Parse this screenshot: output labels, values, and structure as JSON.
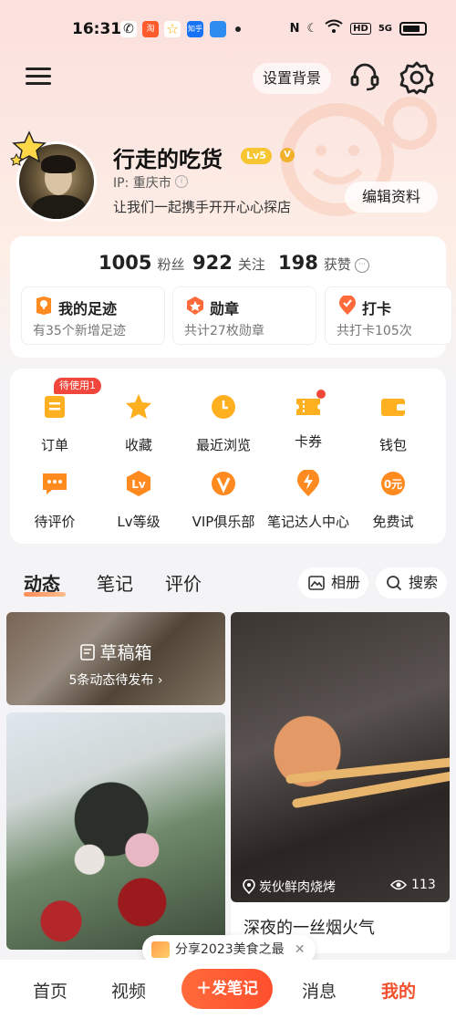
{
  "status_bar": {
    "time": "16:31",
    "apps": [
      {
        "icon": "wechat-icon",
        "color": "#222222"
      },
      {
        "icon": "taobao-icon",
        "color": "#ff5a2b"
      },
      {
        "icon": "star-app-icon",
        "color": "#f5b400"
      },
      {
        "icon": "zhihu-icon",
        "color": "#1772f6"
      },
      {
        "icon": "blue-app-icon",
        "color": "#2e8cf0"
      }
    ],
    "network": "5G",
    "hd": "HD"
  },
  "top_bar": {
    "set_background_label": "设置背景"
  },
  "profile": {
    "username": "行走的吃货",
    "level_badge": "Lv5",
    "v_badge": "V",
    "ip_label": "IP: 重庆市",
    "bio": "让我们一起携手开开心心探店",
    "edit_button": "编辑资料"
  },
  "stats": {
    "fans_count": "1005",
    "fans_label": "粉丝",
    "following_count": "922",
    "following_label": "关注",
    "likes_count": "198",
    "likes_label": "获赞"
  },
  "quick_cards": [
    {
      "title": "我的足迹",
      "subtitle": "有35个新增足迹",
      "icon": "map-pin-icon"
    },
    {
      "title": "勋章",
      "subtitle": "共计27枚勋章",
      "icon": "medal-icon"
    },
    {
      "title": "打卡",
      "subtitle": "共打卡105次",
      "icon": "checkin-icon"
    }
  ],
  "services": {
    "pending_badge": "待使用1",
    "row1": [
      {
        "label": "订单",
        "icon": "order-icon"
      },
      {
        "label": "收藏",
        "icon": "star-icon"
      },
      {
        "label": "最近浏览",
        "icon": "clock-icon"
      },
      {
        "label": "卡券",
        "icon": "coupon-icon"
      },
      {
        "label": "钱包",
        "icon": "wallet-icon"
      }
    ],
    "row2": [
      {
        "label": "待评价",
        "icon": "comment-icon"
      },
      {
        "label": "Lv等级",
        "icon": "level-icon"
      },
      {
        "label": "VIP俱乐部",
        "icon": "vip-icon"
      },
      {
        "label": "笔记达人中心",
        "icon": "lightning-icon"
      },
      {
        "label": "免费试",
        "icon": "free-trial-icon"
      }
    ]
  },
  "content_tabs": {
    "tabs": [
      "动态",
      "笔记",
      "评价"
    ],
    "album_label": "相册",
    "search_label": "搜索"
  },
  "feed": {
    "draft_title": "草稿箱",
    "draft_subtitle": "5条动态待发布",
    "post_location": "炭伙鲜肉烧烤",
    "post_views": "113",
    "post_title": "深夜的一丝烟火气"
  },
  "share_chip": {
    "label": "分享2023美食之最"
  },
  "bottom_nav": {
    "home": "首页",
    "video": "视频",
    "post": "发笔记",
    "messages": "消息",
    "me": "我的"
  },
  "colors": {
    "accent": "#ff5a2e",
    "badge_red": "#f0463c",
    "level_yellow": "#f7c531",
    "icon_orange": "#ff8a1f"
  }
}
